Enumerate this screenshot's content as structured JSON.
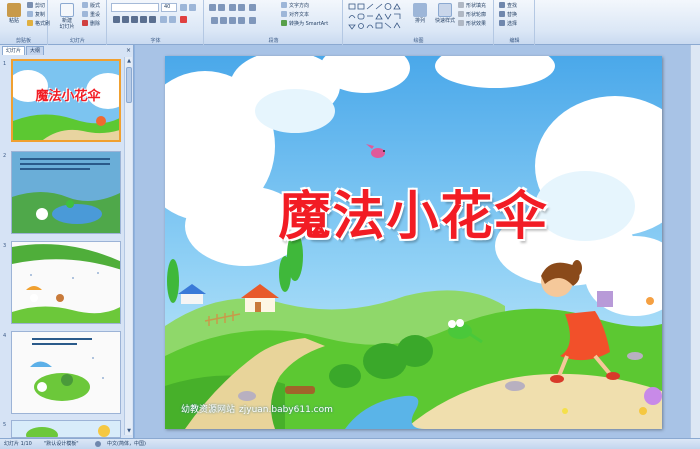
{
  "ribbon": {
    "clipboard": {
      "paste": "粘贴",
      "cut": "剪切",
      "copy": "复制",
      "format_painter": "格式刷",
      "label": "剪贴板"
    },
    "slides": {
      "new_slide": "新建\n幻灯片",
      "layout": "版式",
      "reset": "重设",
      "delete": "删除",
      "label": "幻灯片"
    },
    "font": {
      "font_name": "",
      "font_size": "40",
      "label": "字体"
    },
    "paragraph": {
      "text_direction": "文字方向",
      "align_text": "对齐文本",
      "smartart": "转换为 SmartArt",
      "label": "段落"
    },
    "drawing": {
      "arrange": "排列",
      "quick_styles": "快速样式",
      "shape_fill": "形状填充",
      "shape_outline": "形状轮廓",
      "shape_effects": "形状效果",
      "label": "绘图"
    },
    "editing": {
      "find": "查找",
      "replace": "替换",
      "select": "选择",
      "label": "编辑"
    }
  },
  "panel": {
    "tab_slides": "幻灯片",
    "tab_outline": "大纲",
    "close": "×",
    "thumbnails": [
      {
        "number": "1",
        "title": "魔法小花伞"
      },
      {
        "number": "2"
      },
      {
        "number": "3"
      },
      {
        "number": "4"
      },
      {
        "number": "5"
      }
    ]
  },
  "slide": {
    "title": "魔法小花伞",
    "watermark_site": "幼教资源网站",
    "watermark_url": "zjyuan.baby611.com"
  },
  "statusbar": {
    "slide_position": "幻灯片 1/10",
    "theme": "\"默认设计模板\"",
    "language": "中文(简体，中国)"
  },
  "colors": {
    "title_red": "#f21c24",
    "sky_blue": "#4aa8ea",
    "grass_green": "#5cc832",
    "ribbon_bg": "#dbe7f6"
  }
}
